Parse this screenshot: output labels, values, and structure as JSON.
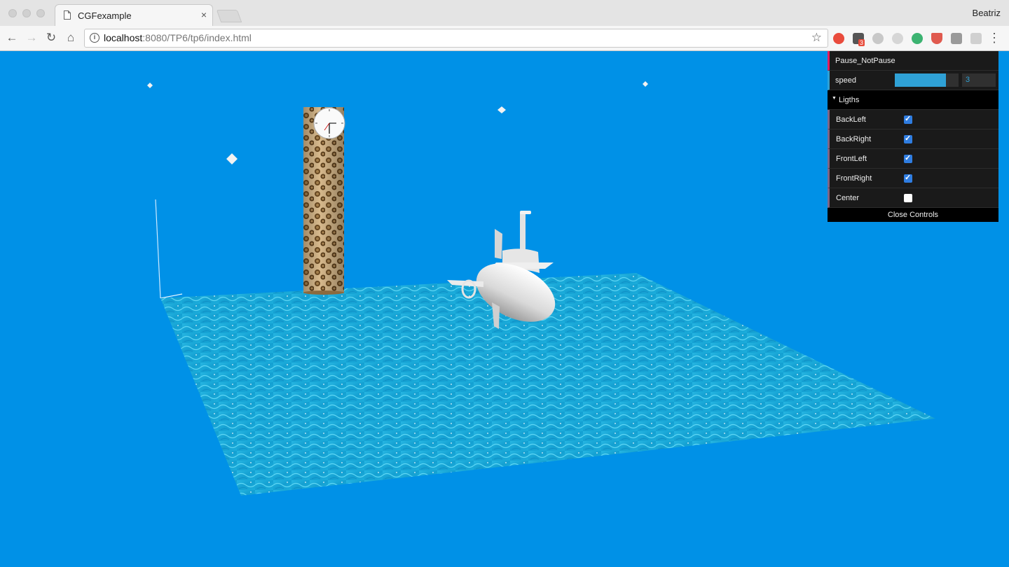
{
  "browser": {
    "tab_title": "CGFexample",
    "tab_close": "×",
    "profile_name": "Beatriz",
    "url_host": "localhost",
    "url_rest": ":8080/TP6/tp6/index.html",
    "ext_badge": "3",
    "nav": {
      "back": "←",
      "forward": "→",
      "reload": "↻",
      "home": "⌂",
      "star": "☆",
      "menu": "⋮"
    }
  },
  "gui": {
    "pause_label": "Pause_NotPause",
    "speed_label": "speed",
    "speed_value": "3",
    "speed_fill_fraction": 0.8,
    "folder_label": "Ligths",
    "folder_caret": "▼",
    "lights": [
      {
        "label": "BackLeft",
        "checked": true
      },
      {
        "label": "BackRight",
        "checked": true
      },
      {
        "label": "FrontLeft",
        "checked": true
      },
      {
        "label": "FrontRight",
        "checked": true
      },
      {
        "label": "Center",
        "checked": false
      }
    ],
    "close_label": "Close Controls"
  },
  "colors": {
    "scene_background": "#0091e7",
    "water_dark": "#1aa6d3",
    "water_light": "#49d5f5",
    "gui_background": "#1a1a1a",
    "number_accent": "#2fa1d6",
    "function_accent": "#e61d5f",
    "checkbox_on": "#2f7de1"
  }
}
